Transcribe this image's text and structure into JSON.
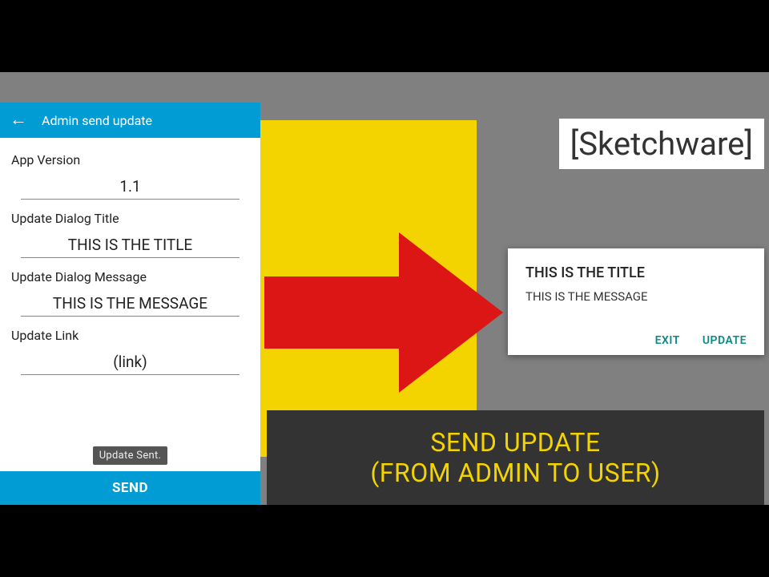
{
  "phone": {
    "appbar_title": "Admin send update",
    "fields": {
      "app_version_label": "App Version",
      "app_version_value": "1.1",
      "dialog_title_label": "Update Dialog Title",
      "dialog_title_value": "THIS IS THE TITLE",
      "dialog_message_label": "Update Dialog Message",
      "dialog_message_value": "THIS IS THE MESSAGE",
      "update_link_label": "Update Link",
      "update_link_value": "(link)"
    },
    "toast": "Update Sent.",
    "send_button": "SEND"
  },
  "sketchware_label": "[Sketchware]",
  "dialog": {
    "title": "THIS IS THE TITLE",
    "message": "THIS IS THE MESSAGE",
    "exit": "EXIT",
    "update": "UPDATE"
  },
  "caption": {
    "line1": "SEND UPDATE",
    "line2": "(FROM ADMIN TO USER)"
  }
}
